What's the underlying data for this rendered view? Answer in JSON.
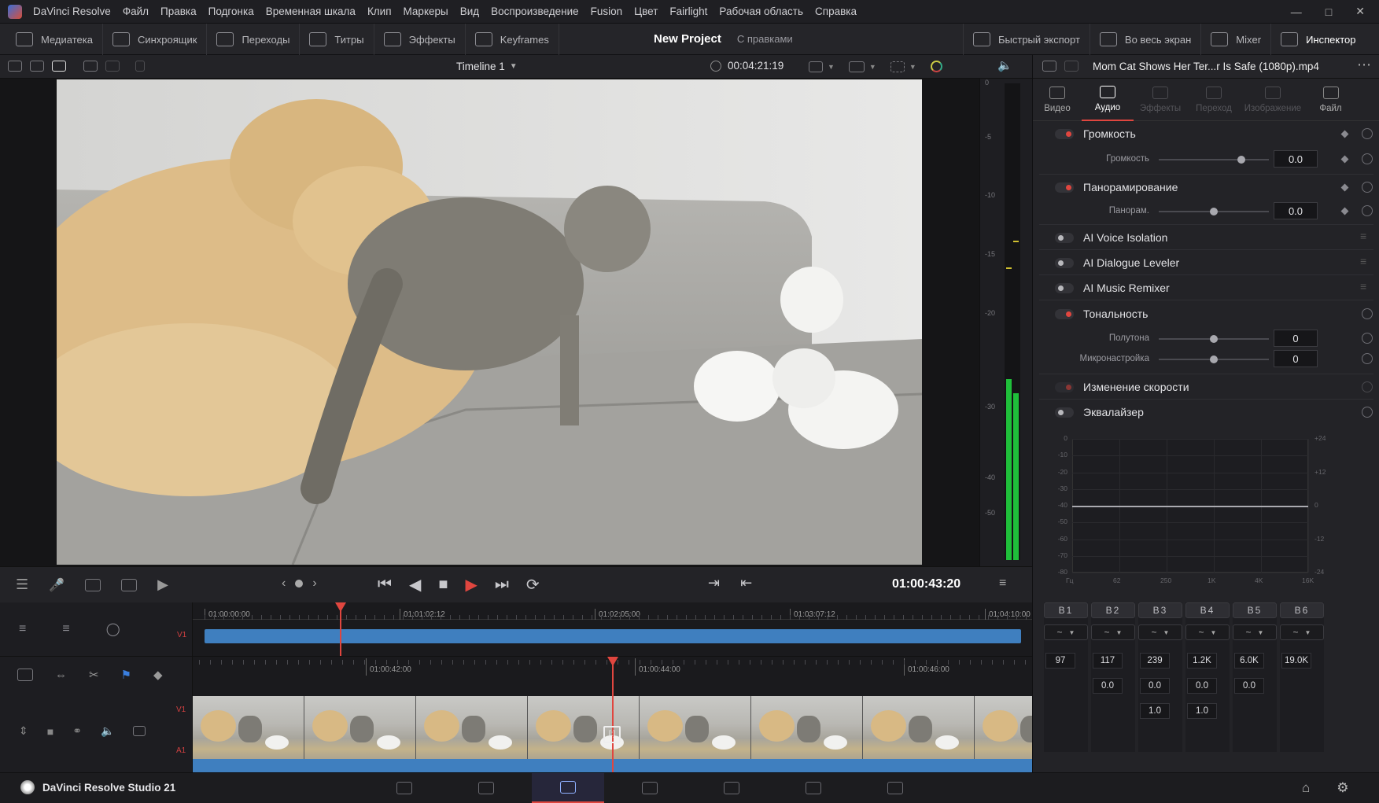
{
  "app": {
    "name": "DaVinci Resolve",
    "menu": [
      "Файл",
      "Правка",
      "Подгонка",
      "Временная шкала",
      "Клип",
      "Маркеры",
      "Вид",
      "Воспроизведение",
      "Fusion",
      "Цвет",
      "Fairlight",
      "Рабочая область",
      "Справка"
    ]
  },
  "toolbar": {
    "left": [
      {
        "label": "Медиатека",
        "icon": "media-pool-icon"
      },
      {
        "label": "Синхроящик",
        "icon": "sync-bin-icon"
      },
      {
        "label": "Переходы",
        "icon": "transitions-icon"
      },
      {
        "label": "Титры",
        "icon": "titles-icon"
      },
      {
        "label": "Эффекты",
        "icon": "effects-icon"
      },
      {
        "label": "Keyframes",
        "icon": "keyframes-icon"
      }
    ],
    "project_title": "New Project",
    "project_status": "С правками",
    "right": [
      {
        "label": "Быстрый экспорт",
        "icon": "quick-export-icon"
      },
      {
        "label": "Во весь экран",
        "icon": "fullscreen-icon"
      },
      {
        "label": "Mixer",
        "icon": "mixer-icon"
      },
      {
        "label": "Инспектор",
        "icon": "inspector-icon"
      }
    ]
  },
  "viewer": {
    "timeline_name": "Timeline 1",
    "duration": "00:04:21:19",
    "meter_ticks": [
      "0",
      "-5",
      "-10",
      "-15",
      "-20",
      "-30",
      "-40",
      "-50"
    ],
    "meter_level": 0.38
  },
  "transport": {
    "timecode": "01:00:43:20"
  },
  "timeline": {
    "upper_ruler": [
      "01:00:00:00",
      "01:01:02:12",
      "01:02:05:00",
      "01:03:07:12",
      "01:04:10:00"
    ],
    "lower_ruler": [
      "01:00:42:00",
      "01:00:44:00",
      "01:00:46:00"
    ],
    "track_labels": {
      "v1_upper": "V1",
      "v1": "V1",
      "a1": "A1"
    }
  },
  "inspector": {
    "clip_name": "Mom Cat Shows Her Ter...r Is Safe (1080p).mp4",
    "tabs": [
      {
        "label": "Видео",
        "active": false,
        "dim": false
      },
      {
        "label": "Аудио",
        "active": true,
        "dim": false
      },
      {
        "label": "Эффекты",
        "active": false,
        "dim": true
      },
      {
        "label": "Переход",
        "active": false,
        "dim": true
      },
      {
        "label": "Изображение",
        "active": false,
        "dim": true
      },
      {
        "label": "Файл",
        "active": false,
        "dim": false
      }
    ],
    "volume": {
      "title": "Громкость",
      "param": "Громкость",
      "value": "0.0",
      "slider": 0.75
    },
    "pan": {
      "title": "Панорамирование",
      "param": "Панорам.",
      "value": "0.0",
      "slider": 0.5
    },
    "ai_voice": "AI Voice Isolation",
    "ai_dialogue": "AI Dialogue Leveler",
    "ai_music": "AI Music Remixer",
    "pitch": {
      "title": "Тональность",
      "semitones_label": "Полутона",
      "semitones_value": "0",
      "fine_label": "Микронастройка",
      "fine_value": "0",
      "slider": 0.5
    },
    "speed": "Изменение скорости",
    "eq": {
      "title": "Эквалайзер",
      "y_left": [
        "0",
        "-10",
        "-20",
        "-30",
        "-40",
        "-50",
        "-60",
        "-70",
        "-80"
      ],
      "y_right": [
        "+24",
        "+12",
        "0",
        "-12",
        "-24"
      ],
      "x_labels": [
        "Гц",
        "62",
        "250",
        "1K",
        "4K",
        "16K"
      ],
      "bands": [
        {
          "label": "B1",
          "freq": "97",
          "gain": "",
          "q": ""
        },
        {
          "label": "B2",
          "freq": "117",
          "gain": "0.0",
          "q": ""
        },
        {
          "label": "B3",
          "freq": "239",
          "gain": "0.0",
          "q": "1.0"
        },
        {
          "label": "B4",
          "freq": "1.2K",
          "gain": "0.0",
          "q": "1.0"
        },
        {
          "label": "B5",
          "freq": "6.0K",
          "gain": "0.0",
          "q": ""
        },
        {
          "label": "B6",
          "freq": "19.0K",
          "gain": "",
          "q": ""
        }
      ]
    }
  },
  "footer": {
    "product": "DaVinci Resolve Studio 21",
    "pages": [
      "media-page-icon",
      "cut-page-icon",
      "edit-page-icon",
      "fusion-page-icon",
      "color-page-icon",
      "fairlight-page-icon",
      "deliver-page-icon"
    ],
    "active_page": 2
  },
  "colors": {
    "accent": "#e0463f",
    "clip_blue": "#3f7fbf",
    "meter_green": "#1fbf3a",
    "playhead": "#e0463f"
  }
}
